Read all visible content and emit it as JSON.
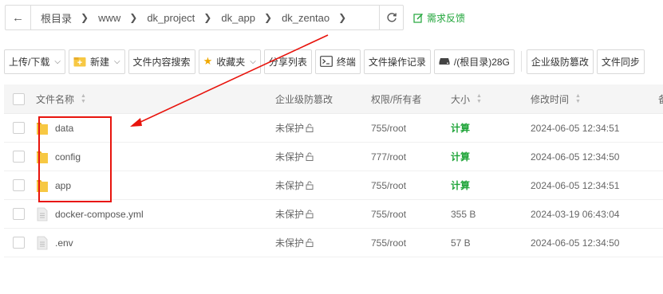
{
  "breadcrumb": {
    "items": [
      "根目录",
      "www",
      "dk_project",
      "dk_app",
      "dk_zentao"
    ]
  },
  "feedback_label": "需求反馈",
  "toolbar": {
    "upload_download": "上传/下载",
    "new": "新建",
    "content_search": "文件内容搜索",
    "favorites": "收藏夹",
    "share_list": "分享列表",
    "terminal": "终端",
    "op_log": "文件操作记录",
    "disk": "/(根目录)28G",
    "tamper_protect": "企业级防篡改",
    "file_sync": "文件同步"
  },
  "table": {
    "headers": {
      "name": "文件名称",
      "protect": "企业级防篡改",
      "perm": "权限/所有者",
      "size": "大小",
      "mtime": "修改时间",
      "extra": "备"
    },
    "rows": [
      {
        "name": "data",
        "type": "folder-icon",
        "protect": "未保护",
        "perm": "755/root",
        "size": "计算",
        "mtime": "2024-06-05 12:34:51"
      },
      {
        "name": "config",
        "type": "folder-icon",
        "protect": "未保护",
        "perm": "777/root",
        "size": "计算",
        "mtime": "2024-06-05 12:34:50"
      },
      {
        "name": "app",
        "type": "folder-icon",
        "protect": "未保护",
        "perm": "755/root",
        "size": "计算",
        "mtime": "2024-06-05 12:34:51"
      },
      {
        "name": "docker-compose.yml",
        "type": "file-icon",
        "protect": "未保护",
        "perm": "755/root",
        "size": "355 B",
        "mtime": "2024-03-19 06:43:04"
      },
      {
        "name": ".env",
        "type": "file-icon",
        "protect": "未保护",
        "perm": "755/root",
        "size": "57 B",
        "mtime": "2024-06-05 12:34:50"
      }
    ]
  },
  "colors": {
    "accent": "#20a53a",
    "annotation": "#e8140d",
    "folder": "#f7c843"
  }
}
